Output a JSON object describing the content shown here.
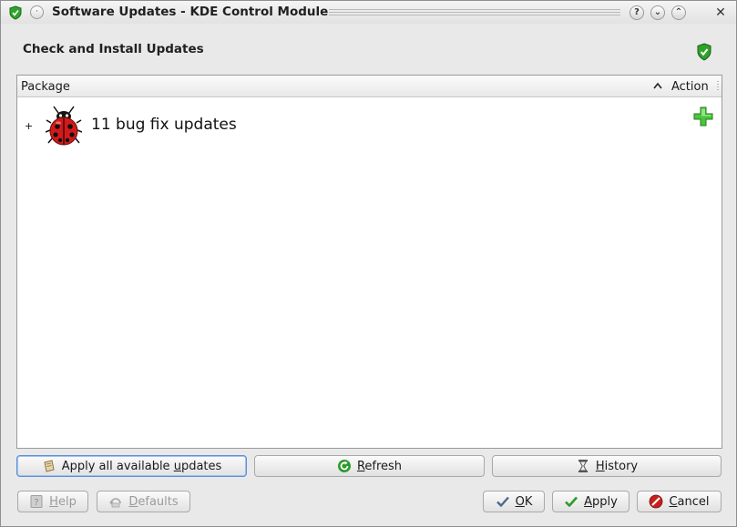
{
  "window": {
    "title": "Software Updates - KDE Control Module",
    "menu_glyph": "·",
    "help_glyph": "?",
    "minimize_glyph": "⌄",
    "maximize_glyph": "⌃",
    "close_glyph": "✕"
  },
  "header": {
    "title": "Check and Install Updates",
    "icon": "green-shield-icon"
  },
  "tree": {
    "columns": {
      "package": "Package",
      "action": "Action",
      "sort": "ascending"
    },
    "rows": [
      {
        "expander": "+",
        "icon": "ladybug-icon",
        "label": "11 bug fix updates",
        "action_icon": "green-plus-icon"
      }
    ]
  },
  "actions": {
    "apply_all": {
      "pre": "Apply all available ",
      "acc": "u",
      "post": "pdates"
    },
    "refresh": {
      "pre": "",
      "acc": "R",
      "post": "efresh"
    },
    "history": {
      "pre": "",
      "acc": "H",
      "post": "istory"
    }
  },
  "dialog_buttons": {
    "help": {
      "pre": "",
      "acc": "H",
      "post": "elp"
    },
    "defaults": {
      "pre": "",
      "acc": "D",
      "post": "efaults"
    },
    "ok": {
      "pre": "",
      "acc": "O",
      "post": "K"
    },
    "apply": {
      "pre": "",
      "acc": "A",
      "post": "pply"
    },
    "cancel": {
      "pre": "",
      "acc": "C",
      "post": "ancel"
    }
  },
  "colors": {
    "accent_focus": "#5b8fd8",
    "shield_green": "#2fa329",
    "ladybug_red": "#d21a1a",
    "cancel_red": "#c8201c"
  }
}
